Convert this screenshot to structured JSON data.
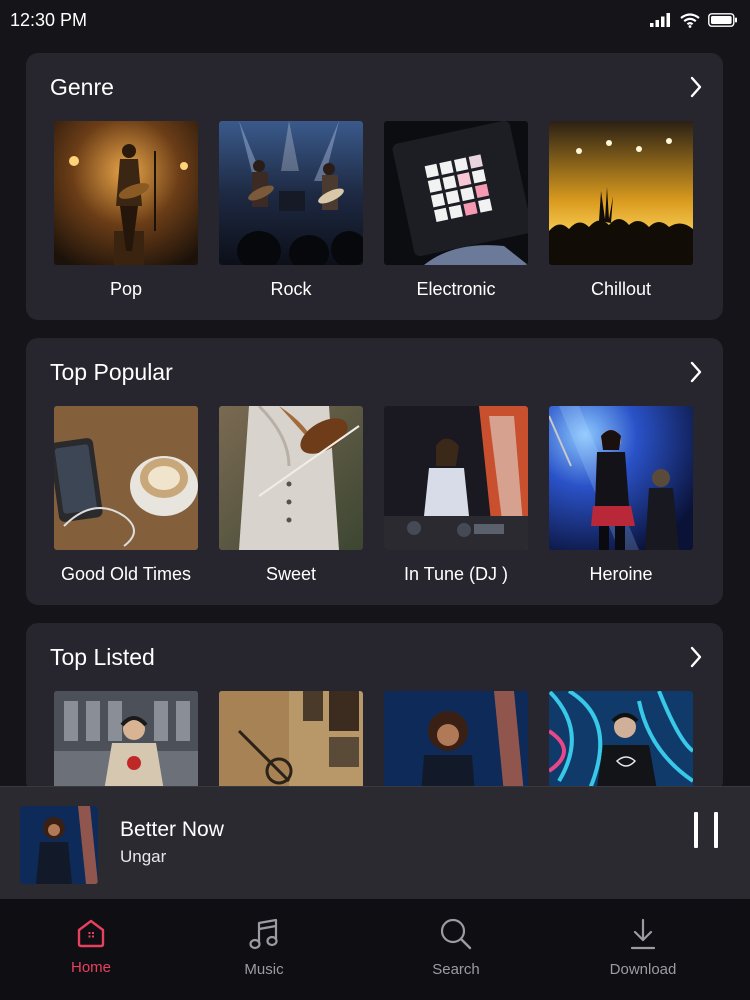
{
  "status_bar": {
    "time": "12:30 PM"
  },
  "sections": {
    "genre": {
      "title": "Genre",
      "items": [
        {
          "label": "Pop"
        },
        {
          "label": "Rock"
        },
        {
          "label": "Electronic"
        },
        {
          "label": "Chillout"
        }
      ]
    },
    "top_popular": {
      "title": "Top Popular",
      "items": [
        {
          "label": "Good Old Times"
        },
        {
          "label": "Sweet"
        },
        {
          "label": "In Tune (DJ )"
        },
        {
          "label": "Heroine"
        }
      ]
    },
    "top_listed": {
      "title": "Top Listed"
    }
  },
  "now_playing": {
    "title": "Better Now",
    "artist": "Ungar"
  },
  "nav": {
    "home": "Home",
    "music": "Music",
    "search": "Search",
    "download": "Download"
  },
  "colors": {
    "background": "#151418",
    "card": "#27252d",
    "accent": "#e8405f",
    "inactive": "#9c9ba2"
  },
  "icons": {
    "section_more": "chevron-right-icon",
    "pause": "pause-icon",
    "home": "home-icon",
    "music": "music-note-icon",
    "search": "search-icon",
    "download": "download-icon"
  }
}
